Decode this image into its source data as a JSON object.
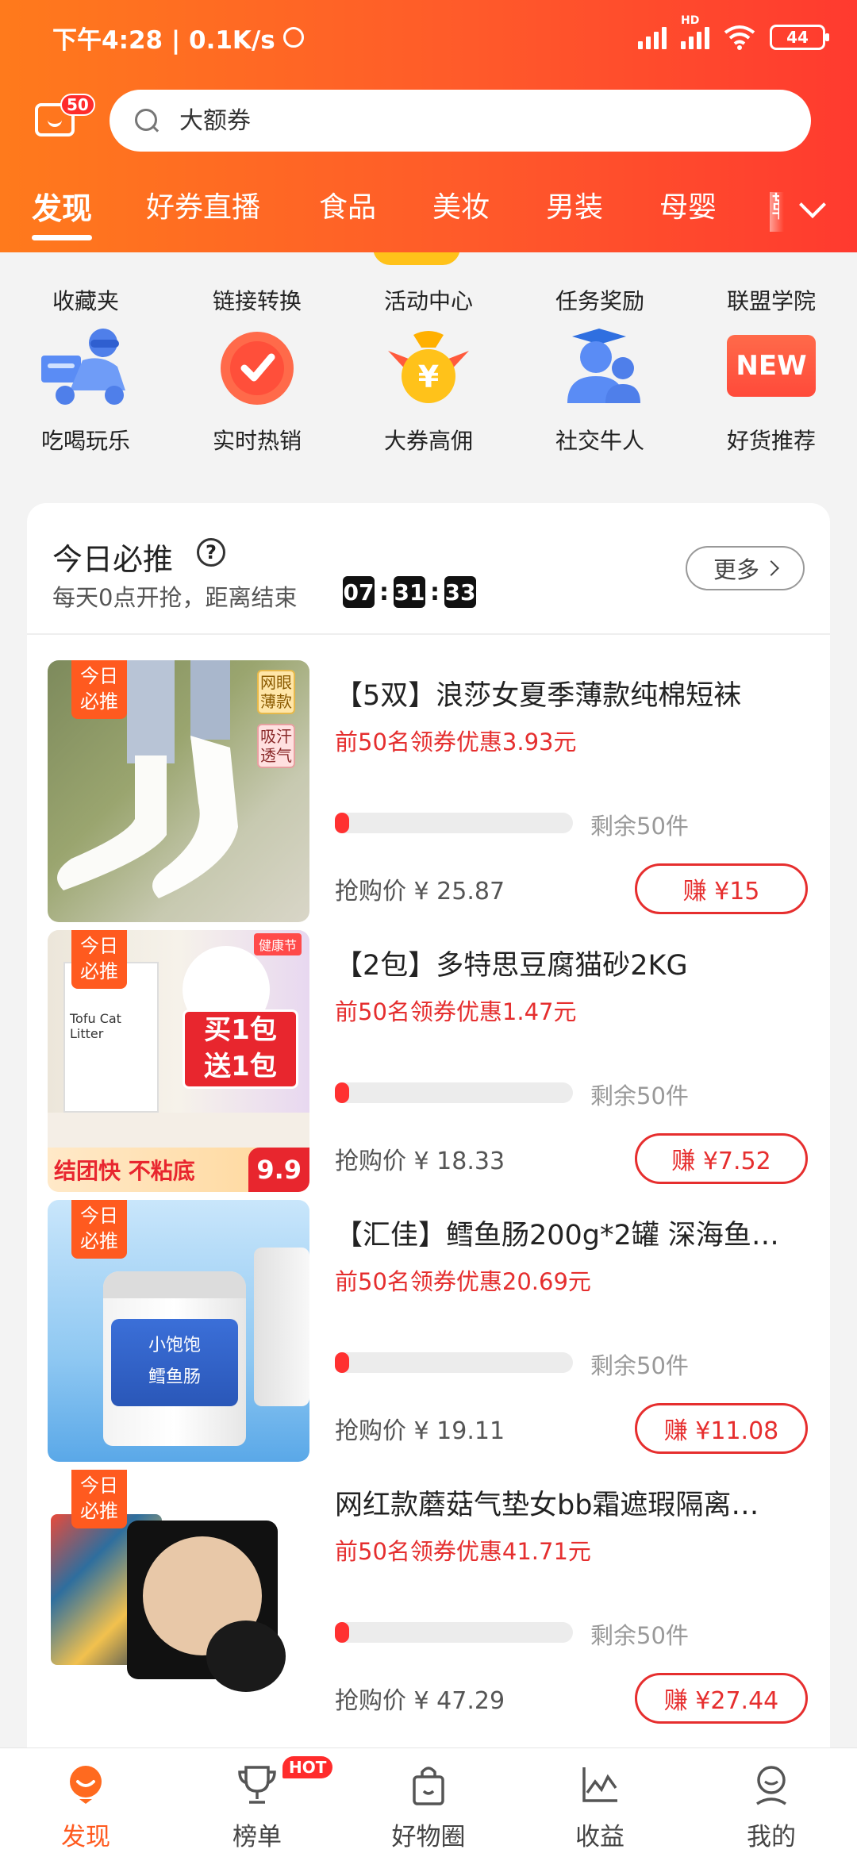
{
  "status_bar": {
    "time": "下午4:28 | 0.1K/s",
    "network": "HD",
    "battery": "44"
  },
  "header": {
    "message_badge": "50",
    "search": {
      "placeholder": "大额券"
    },
    "tabs": [
      {
        "label": "发现"
      },
      {
        "label": "好券直播"
      },
      {
        "label": "食品"
      },
      {
        "label": "美妆"
      },
      {
        "label": "男装"
      },
      {
        "label": "母婴"
      },
      {
        "label": "鞋"
      }
    ]
  },
  "grid": {
    "row1": [
      {
        "label": "收藏夹"
      },
      {
        "label": "链接转换"
      },
      {
        "label": "活动中心"
      },
      {
        "label": "任务奖励"
      },
      {
        "label": "联盟学院"
      }
    ],
    "row2": [
      {
        "label": "吃喝玩乐",
        "icon": "scooter-delivery-icon"
      },
      {
        "label": "实时热销",
        "icon": "clock-icon"
      },
      {
        "label": "大券高佣",
        "icon": "yuan-money-bag-icon"
      },
      {
        "label": "社交牛人",
        "icon": "people-icon"
      },
      {
        "label": "好货推荐",
        "icon": "new-badge-icon",
        "badge_text": "NEW"
      }
    ]
  },
  "daily_picks": {
    "title": "今日必推",
    "subtitle": "每天0点开抢，距离结束",
    "timer": {
      "h": "07",
      "m": "31",
      "s": "33"
    },
    "more_label": "更多",
    "tag_line1": "今日",
    "tag_line2": "必推",
    "products": [
      {
        "title": "【5双】浪莎女夏季薄款纯棉短袜",
        "coupon": "前50名领券优惠3.93元",
        "remaining": "剩余50件",
        "price": "抢购价 ¥ 25.87",
        "earn": "赚 ¥15",
        "progress": 0.06,
        "img_notes": [
          "网眼",
          "薄款",
          "吸汗",
          "透气"
        ]
      },
      {
        "title": "【2包】多特思豆腐猫砂2KG",
        "coupon": "前50名领券优惠1.47元",
        "remaining": "剩余50件",
        "price": "抢购价 ¥ 18.33",
        "earn": "赚 ¥7.52",
        "progress": 0.06,
        "img_notes": [
          "买1包",
          "送1包",
          "结团快 不粘底",
          "9.9",
          "Tofu Cat Litter",
          "健康节"
        ]
      },
      {
        "title": "【汇佳】鳕鱼肠200g*2罐 深海鱼…",
        "coupon": "前50名领券优惠20.69元",
        "remaining": "剩余50件",
        "price": "抢购价 ¥ 19.11",
        "earn": "赚 ¥11.08",
        "progress": 0.06,
        "img_notes": [
          "小饱饱",
          "鳕鱼肠"
        ]
      },
      {
        "title": "网红款蘑菇气垫女bb霜遮瑕隔离…",
        "coupon": "前50名领券优惠41.71元",
        "remaining": "剩余50件",
        "price": "抢购价 ¥ 47.29",
        "earn": "赚 ¥27.44",
        "progress": 0.06,
        "img_notes": []
      }
    ]
  },
  "bottom_nav": [
    {
      "label": "发现",
      "active": true
    },
    {
      "label": "榜单",
      "badge": "HOT"
    },
    {
      "label": "好物圈"
    },
    {
      "label": "收益"
    },
    {
      "label": "我的"
    }
  ],
  "colors": {
    "brand": "#ff5a1f",
    "accent_red": "#e52e2e"
  }
}
